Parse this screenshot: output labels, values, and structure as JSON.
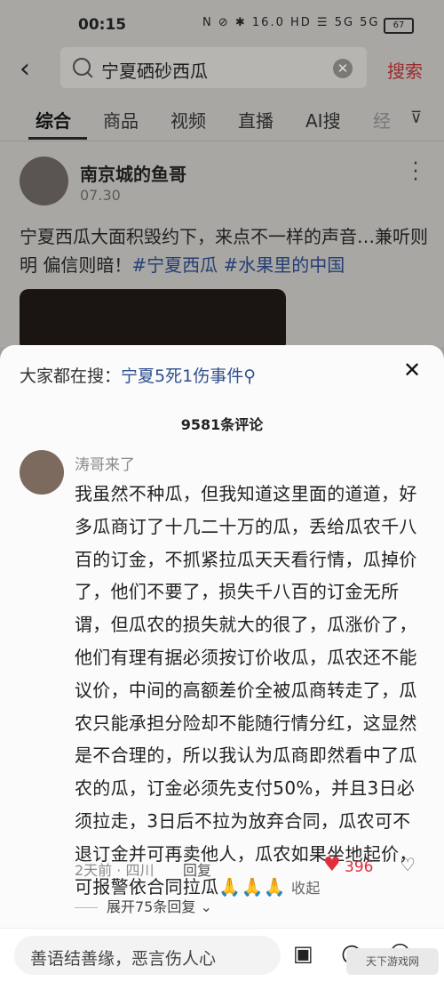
{
  "status": {
    "time": "00:15",
    "icons": "N ⊘ ✱ 16.0 HD ☰ 5G 5G",
    "battery": "67"
  },
  "search": {
    "query": "宁夏硒砂西瓜",
    "button": "搜索"
  },
  "tabs": [
    "综合",
    "商品",
    "视频",
    "直播",
    "AI搜",
    "经"
  ],
  "post": {
    "author": "南京城的鱼哥",
    "date": "07.30",
    "text": "宁夏西瓜大面积毁约下，来点不一样的声音…兼听则明 偏信则暗！",
    "tags": "#宁夏西瓜 #水果里的中国"
  },
  "sheet": {
    "hot_label": "大家都在搜：",
    "hot_keyword": "宁夏5死1伤事件",
    "count": "9581条评论",
    "comment": {
      "author": "涛哥来了",
      "text": "我虽然不种瓜，但我知道这里面的道道，好多瓜商订了十几二十万的瓜，丢给瓜农千八百的订金，不抓紧拉瓜天天看行情，瓜掉价了，他们不要了，损失千八百的订金无所谓，但瓜农的损失就大的很了，瓜涨价了，他们有理有据必须按订价收瓜，瓜农还不能议价，中间的高额差价全被瓜商转走了，瓜农只能承担分险却不能随行情分红，这显然是不合理的，所以我认为瓜商即然看中了瓜农的瓜，订金必须先支付50%，并且3日必须拉走，3日后不拉为放弃合同，瓜农可不退订金并可再卖他人，瓜农如果坐地起价，可报警依合同拉瓜🙏🙏🙏",
      "collapse": "收起",
      "meta": "2天前 · 四川",
      "reply": "回复",
      "likes": "396"
    },
    "expand": "展开75条回复",
    "input_placeholder": "善语结善缘，恶言伤人心",
    "watermark": "天下游戏网"
  }
}
